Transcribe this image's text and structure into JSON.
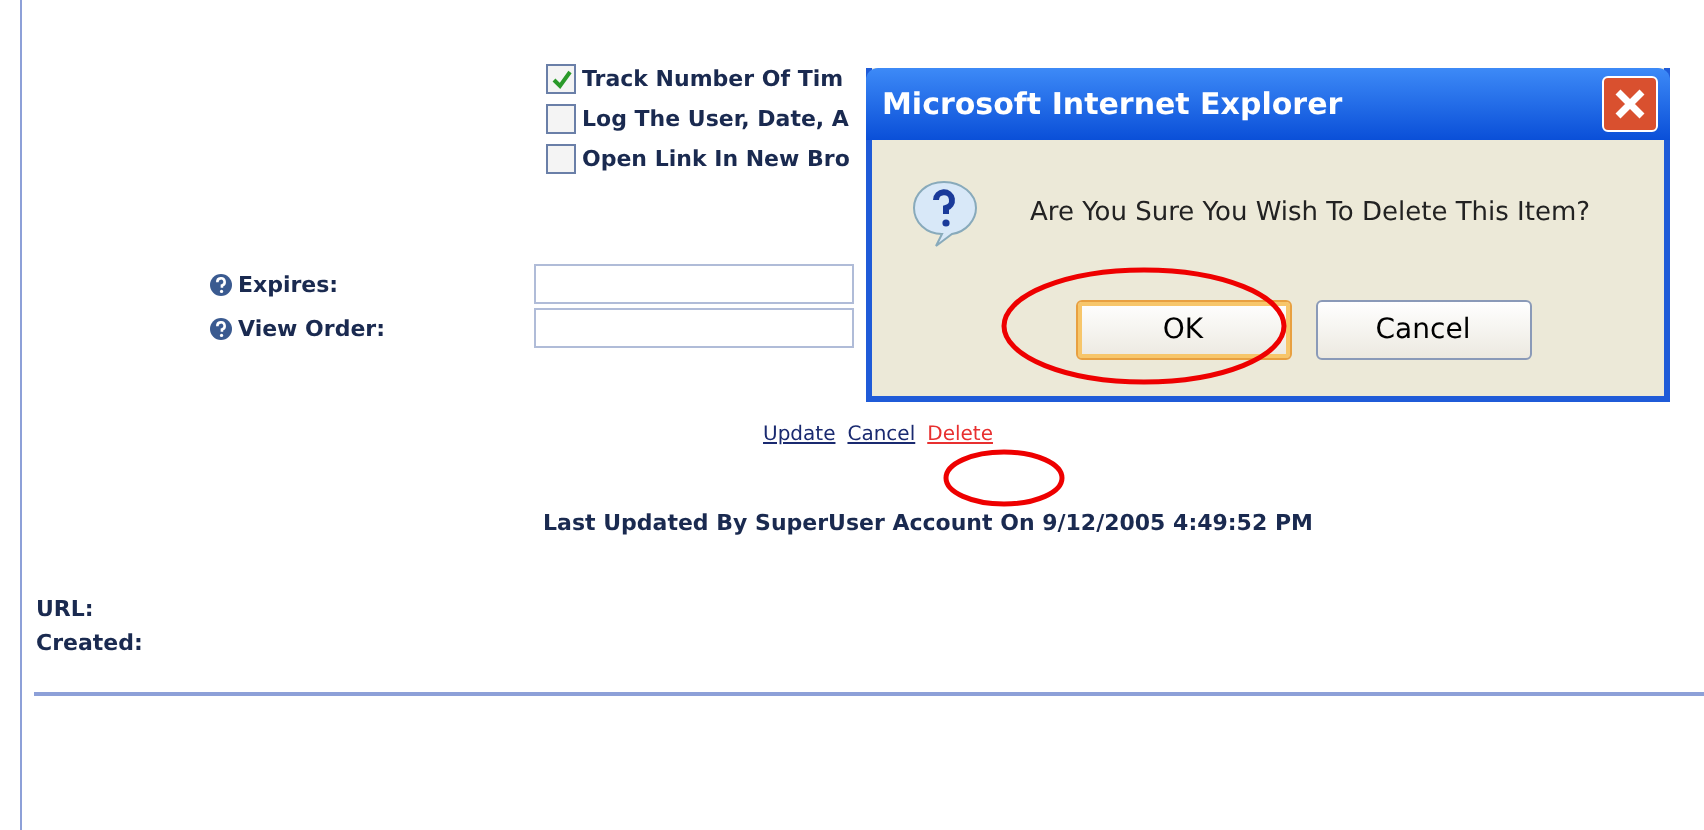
{
  "options": [
    {
      "label": "Track Number Of Tim",
      "checked": true
    },
    {
      "label": "Log The User, Date, A",
      "checked": false
    },
    {
      "label": "Open Link In New Bro",
      "checked": false
    }
  ],
  "fields": [
    {
      "label": "Expires:"
    },
    {
      "label": "View Order:"
    }
  ],
  "links": [
    {
      "label": "Update",
      "kind": "normal"
    },
    {
      "label": "Cancel",
      "kind": "normal"
    },
    {
      "label": "Delete",
      "kind": "danger"
    }
  ],
  "last_updated": "Last Updated By SuperUser Account On 9/12/2005 4:49:52 PM",
  "info": [
    "URL:",
    "Created:"
  ],
  "dialog": {
    "title": "Microsoft Internet Explorer",
    "message": "Are You Sure You Wish To Delete This Item?",
    "buttons": [
      {
        "label": "OK",
        "selected": true
      },
      {
        "label": "Cancel",
        "selected": false
      }
    ]
  }
}
